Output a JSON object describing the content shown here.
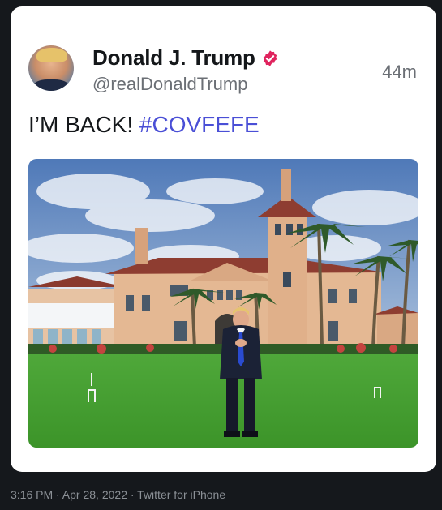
{
  "author": {
    "name": "Donald J. Trump",
    "handle": "@realDonaldTrump"
  },
  "tweet": {
    "time_ago": "44m",
    "text": "I’M BACK!",
    "hashtag": "#COVFEFE"
  },
  "footer": {
    "meta": "3:16 PM · Apr 28, 2022 · Twitter for iPhone"
  },
  "colors": {
    "hashtag": "#4a4fd6",
    "verified": "#e0245e",
    "background": "#15181c"
  },
  "icons": {
    "verified": "verified-badge-icon"
  }
}
